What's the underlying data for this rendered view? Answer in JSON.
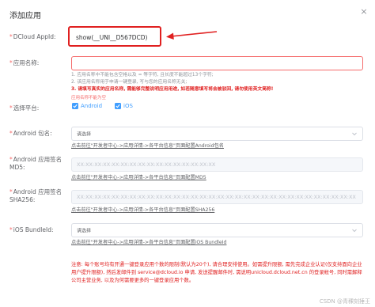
{
  "dialog": {
    "title": "添加应用",
    "close": "×"
  },
  "fields": {
    "appid": {
      "label": "DCloud AppId:",
      "value": "show(__UNI__D567DCD)"
    },
    "app_name": {
      "label": "应用名称:",
      "value": "",
      "hints": [
        "1. 应用名称中不能包含空格以及 = 等字符, 且长度不能超过13个字符;",
        "2. 该应用名称用于申请一键登录, 写与您的应用名称无关;",
        "3. 请填写真实的应用名称, 需能够完整说明应用用途, 如若随意填写将会被驳回, 请勿使用英文简称!"
      ],
      "error": "应用名称不能为空"
    },
    "platform": {
      "label": "选择平台:",
      "options": [
        "Android",
        "iOS"
      ]
    },
    "android_pkg": {
      "label": "Android 包名:",
      "placeholder": "请选择",
      "link": "点击前往\"开发者中心->应用详情->各平台信息\"页面配置Android包名"
    },
    "android_md5": {
      "label_line1": "Android 应用签名",
      "label_line2": "MD5:",
      "placeholder": "XX:XX:XX:XX:XX:XX:XX:XX:XX:XX:XX:XX:XX:XX:XX:XX",
      "link": "点击前往\"开发者中心->应用详情->各平台信息\"页面配置MD5"
    },
    "android_sha": {
      "label_line1": "Android 应用签名",
      "label_line2": "SHA256:",
      "placeholder": "XX:XX:XX:XX:XX:XX:XX:XX:XX:XX:XX:XX:XX:XX:XX:XX:XX:XX:XX:XX:XX:XX:XX:XX:XX:XX:XX:XX:XX:XX:XX:XX",
      "link": "点击前往\"开发者中心->应用详情->各平台信息\"页面配置SHA256"
    },
    "ios_bundle": {
      "label": "iOS BundleId:",
      "placeholder": "请选择",
      "link": "点击前往\"开发者中心->应用详情->各平台信息\"页面配置iOS BundleId"
    }
  },
  "notice": "注意: 每个账号均有开通一键登录应用个数的限制(默认为20个), 请合理安排使用。如需提升限额, 需先完成企业认证(仅支持面向企业用户提升限额), 然后发邮件到 service@dcloud.io 申请, 发送提醒邮件时, 需说明unicloud.dcloud.net.cn 的登录帐号, 同时需解释公司主营业务, 以及为何需要更多的一键登录应用个数。",
  "watermark": "CSDN @青稞刻捶王",
  "colors": {
    "accent": "#409eff",
    "error": "#f56c6c",
    "highlight": "#e02020"
  }
}
